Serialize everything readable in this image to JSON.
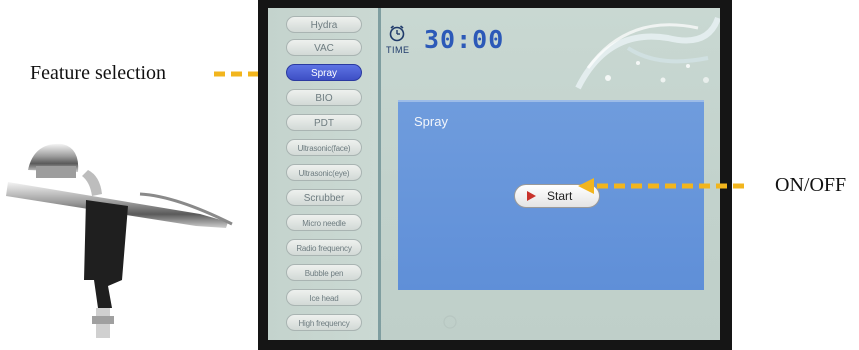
{
  "annotations": {
    "feature_selection": "Feature selection",
    "on_off": "ON/OFF",
    "arrow_color": "#f2b51d"
  },
  "device": {
    "sidebar": {
      "items": [
        {
          "label": "Hydra",
          "active": false
        },
        {
          "label": "VAC",
          "active": false
        },
        {
          "label": "Spray",
          "active": true
        },
        {
          "label": "BIO",
          "active": false
        },
        {
          "label": "PDT",
          "active": false
        },
        {
          "label": "Ultrasonic(face)",
          "active": false
        },
        {
          "label": "Ultrasonic(eye)",
          "active": false
        },
        {
          "label": "Scrubber",
          "active": false
        },
        {
          "label": "Micro needle",
          "active": false
        },
        {
          "label": "Radio frequency",
          "active": false
        },
        {
          "label": "Bubble pen",
          "active": false
        },
        {
          "label": "Ice head",
          "active": false
        },
        {
          "label": "High frequency",
          "active": false
        }
      ]
    },
    "header": {
      "clock_icon": "alarm-clock-icon",
      "time_label": "TIME",
      "timer": "30:00"
    },
    "panel": {
      "title": "Spray",
      "start_label": "Start",
      "start_icon": "play-icon"
    },
    "colors": {
      "active_item": "#4a5fd6",
      "panel_blue": "#6a97db",
      "timer_blue": "#2c59b8"
    }
  }
}
